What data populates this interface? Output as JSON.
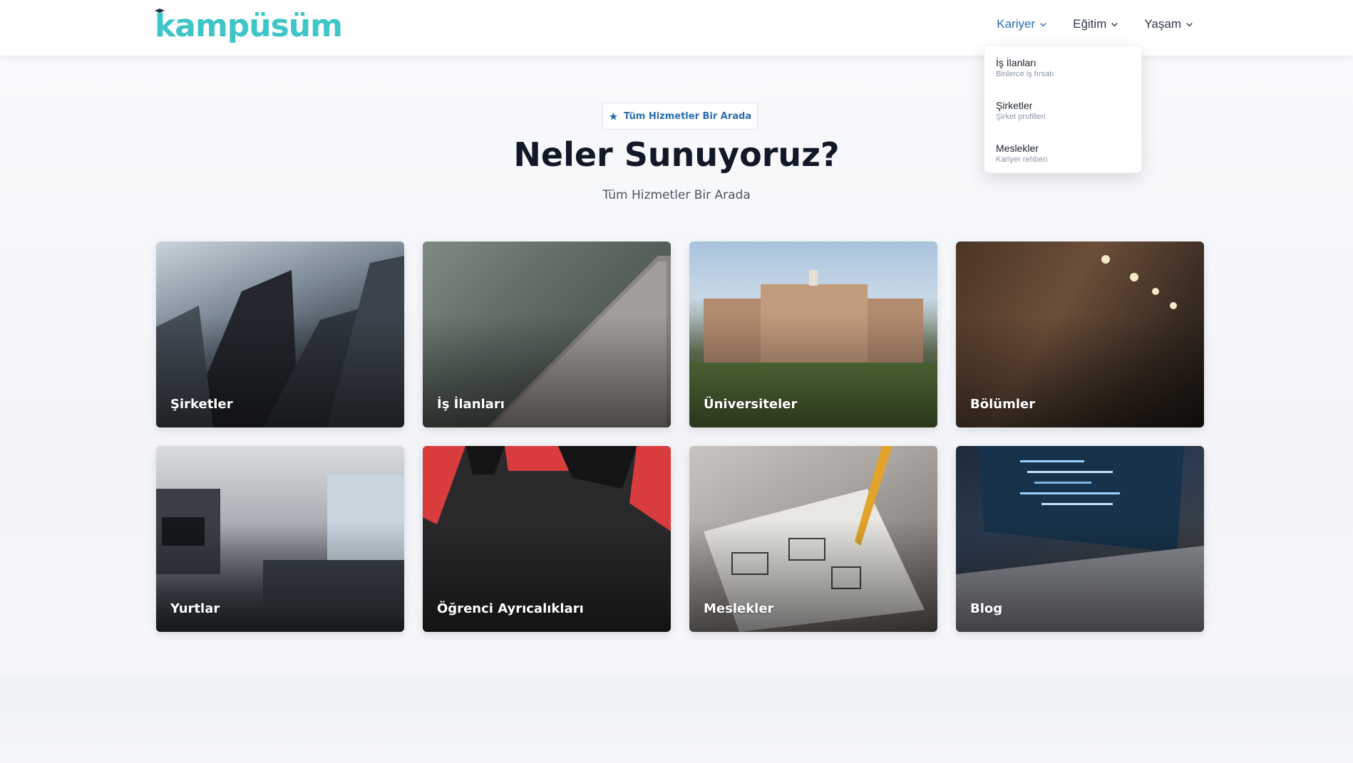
{
  "header": {
    "logo": "kampüsüm",
    "nav": [
      {
        "label": "Kariyer",
        "active": true
      },
      {
        "label": "Eğitim",
        "active": false
      },
      {
        "label": "Yaşam",
        "active": false
      }
    ]
  },
  "dropdown": {
    "items": [
      {
        "title": "İş İlanları",
        "subtitle": "Binlerce iş fırsatı"
      },
      {
        "title": "Şirketler",
        "subtitle": "Şirket profilleri"
      },
      {
        "title": "Meslekler",
        "subtitle": "Kariyer rehberi"
      }
    ]
  },
  "hero": {
    "badge": "Tüm Hizmetler Bir Arada",
    "title": "Neler Sunuyoruz?",
    "subtitle": "Tüm Hizmetler Bir Arada"
  },
  "services": [
    {
      "label": "Şirketler",
      "icon": "skyscrapers-photo"
    },
    {
      "label": "İş İlanları",
      "icon": "love-card-photo"
    },
    {
      "label": "Üniversiteler",
      "icon": "university-building-photo"
    },
    {
      "label": "Bölümler",
      "icon": "library-shelves-photo"
    },
    {
      "label": "Yurtlar",
      "icon": "living-room-photo"
    },
    {
      "label": "Öğrenci Ayrıcalıkları",
      "icon": "shopping-bags-photo"
    },
    {
      "label": "Meslekler",
      "icon": "sketching-photo"
    },
    {
      "label": "Blog",
      "icon": "laptop-code-photo"
    }
  ],
  "colors": {
    "brand": "#3ec5c8",
    "accent": "#2b6cb0",
    "title": "#111827"
  }
}
